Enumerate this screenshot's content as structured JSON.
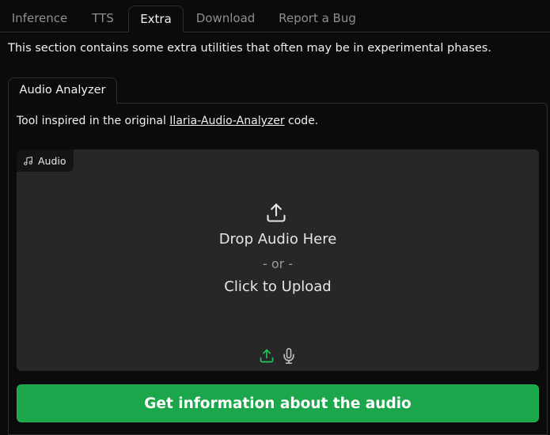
{
  "tabs": {
    "items": [
      {
        "label": "Inference"
      },
      {
        "label": "TTS"
      },
      {
        "label": "Extra"
      },
      {
        "label": "Download"
      },
      {
        "label": "Report a Bug"
      }
    ],
    "active": "Extra"
  },
  "extra": {
    "description": "This section contains some extra utilities that often may be in experimental phases.",
    "subtab_label": "Audio Analyzer",
    "tool_desc_prefix": "Tool inspired in the original ",
    "tool_desc_link": "Ilaria-Audio-Analyzer",
    "tool_desc_suffix": " code.",
    "audio_input": {
      "label": "Audio",
      "label_icon": "music-note-icon",
      "drop_text": "Drop Audio Here",
      "or_text": "- or -",
      "click_text": "Click to Upload",
      "upload_icon": "upload-icon",
      "sources": [
        "upload-icon",
        "microphone-icon"
      ]
    },
    "button_label": "Get information about the audio"
  },
  "colors": {
    "background": "#0b0b0b",
    "dropzone": "#272727",
    "accent": "#1ca64c",
    "source_active": "#22c55e"
  }
}
